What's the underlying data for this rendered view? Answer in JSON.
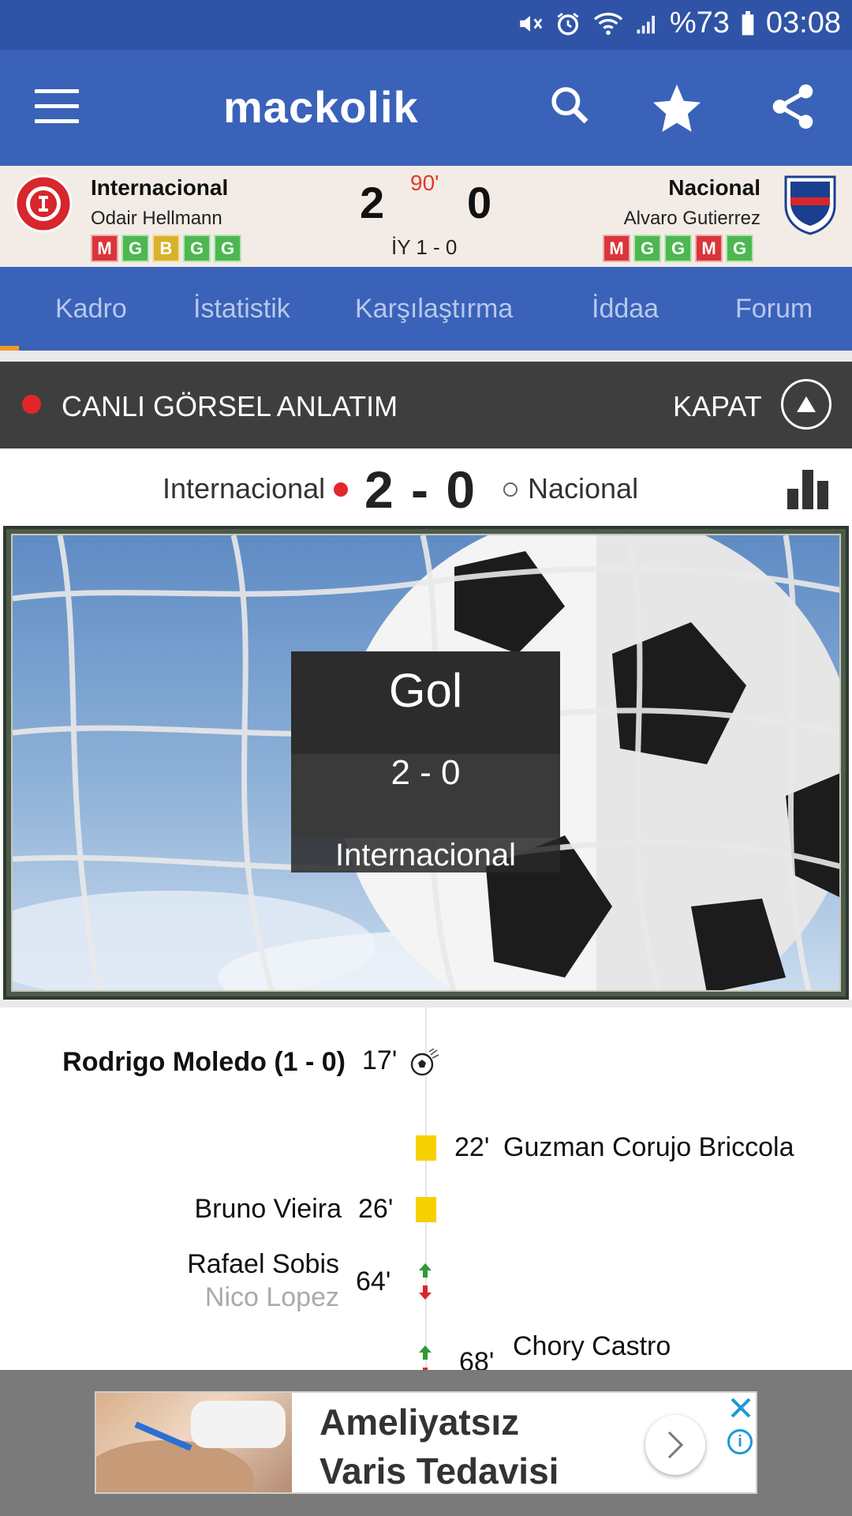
{
  "status_bar": {
    "battery": "%73",
    "time": "03:08"
  },
  "app_bar": {
    "logo": "mackolik"
  },
  "match": {
    "home": {
      "name": "Internacional",
      "coach": "Odair Hellmann",
      "score": "2",
      "form": [
        "M",
        "G",
        "B",
        "G",
        "G"
      ]
    },
    "away": {
      "name": "Nacional",
      "coach": "Alvaro Gutierrez",
      "score": "0",
      "form": [
        "M",
        "G",
        "G",
        "M",
        "G"
      ]
    },
    "minute": "90'",
    "half_time": "İY 1 - 0"
  },
  "form_colors": {
    "M": "#d9363a",
    "G": "#4cb84f",
    "B": "#d9b12d"
  },
  "tabs": [
    "Kadro",
    "İstatistik",
    "Karşılaştırma",
    "İddaa",
    "Forum"
  ],
  "live": {
    "title": "CANLI GÖRSEL ANLATIM",
    "close_label": "KAPAT"
  },
  "score_line": {
    "home": "Internacional",
    "score": "2 - 0",
    "away": "Nacional"
  },
  "event": {
    "title": "Gol",
    "score": "2  -  0",
    "team": "Internacional"
  },
  "timeline": {
    "e1": {
      "player": "Rodrigo Moledo (1 - 0)",
      "minute": "17'"
    },
    "e2": {
      "minute": "22'",
      "player": "Guzman Corujo Briccola"
    },
    "e3": {
      "player": "Bruno Vieira",
      "minute": "26'"
    },
    "e4": {
      "player_in": "Rafael Sobis",
      "player_out": "Nico Lopez",
      "minute": "64'"
    },
    "e5": {
      "minute": "68'",
      "player_in": "Chory Castro"
    }
  },
  "ad": {
    "line1": "Ameliyatsız",
    "line2": "Varis Tedavisi"
  }
}
